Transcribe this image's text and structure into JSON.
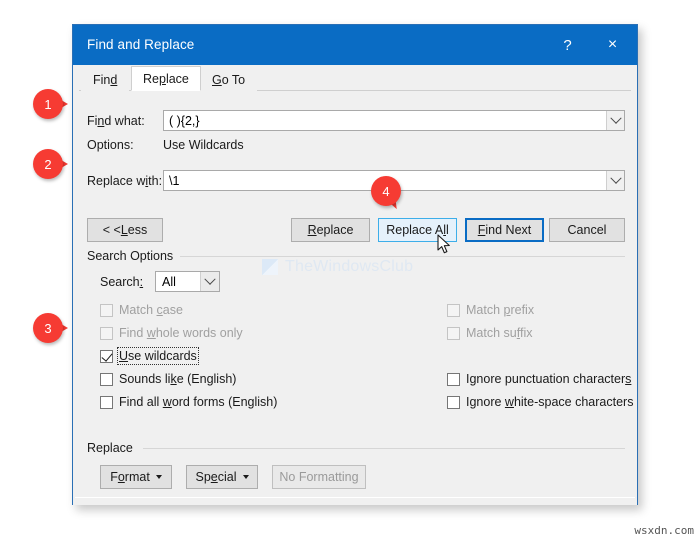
{
  "window": {
    "title": "Find and Replace",
    "help_icon": "?",
    "close_icon": "×"
  },
  "tabs": [
    {
      "label": "Find",
      "accel_before": "Fin",
      "accel": "d",
      "accel_after": "",
      "active": false
    },
    {
      "label": "Replace",
      "accel_before": "Re",
      "accel": "p",
      "accel_after": "lace",
      "active": true
    },
    {
      "label": "Go To",
      "accel_before": "",
      "accel": "G",
      "accel_after": "o To",
      "active": false
    }
  ],
  "fields": {
    "find_what_label": "Find what:",
    "find_what_accel_before": "Fi",
    "find_what_accel": "n",
    "find_what_accel_after": "d what:",
    "find_what_value": "( ){2,}",
    "options_label": "Options:",
    "options_value": "Use Wildcards",
    "replace_with_label": "Replace with:",
    "replace_with_accel_before": "Replace w",
    "replace_with_accel": "i",
    "replace_with_accel_after": "th:",
    "replace_with_value": "\\1"
  },
  "buttons": {
    "less": "< < Less",
    "less_accel_before": "< < ",
    "less_accel": "L",
    "less_accel_after": "ess",
    "replace": "Replace",
    "replace_accel_before": "",
    "replace_accel": "R",
    "replace_accel_after": "eplace",
    "replace_all": "Replace All",
    "replace_all_accel_before": "Replace A",
    "replace_all_accel": "l",
    "replace_all_accel_after": "l",
    "find_next": "Find Next",
    "find_next_accel_before": "",
    "find_next_accel": "F",
    "find_next_accel_after": "ind Next",
    "cancel": "Cancel"
  },
  "search_options": {
    "group_label": "Search Options",
    "search_label": "Search:",
    "search_accel_before": "Search",
    "search_accel": ":",
    "search_accel_after": "",
    "search_value": "All",
    "left_checkboxes": [
      {
        "label": "Match case",
        "accel_before": "Match ",
        "accel": "c",
        "accel_after": "ase",
        "checked": false,
        "disabled": true,
        "focused": false
      },
      {
        "label": "Find whole words only",
        "accel_before": "Find ",
        "accel": "w",
        "accel_after": "hole words only",
        "checked": false,
        "disabled": true,
        "focused": false
      },
      {
        "label": "Use wildcards",
        "accel_before": "",
        "accel": "U",
        "accel_after": "se wildcards",
        "checked": true,
        "disabled": false,
        "focused": true
      },
      {
        "label": "Sounds like (English)",
        "accel_before": "Sounds li",
        "accel": "k",
        "accel_after": "e (English)",
        "checked": false,
        "disabled": false,
        "focused": false
      },
      {
        "label": "Find all word forms (English)",
        "accel_before": "Find all ",
        "accel": "w",
        "accel_after": "ord forms (English)",
        "checked": false,
        "disabled": false,
        "focused": false
      }
    ],
    "right_checkboxes": [
      {
        "label": "Match prefix",
        "accel_before": "Match ",
        "accel": "p",
        "accel_after": "refix",
        "checked": false,
        "disabled": true,
        "focused": false
      },
      {
        "label": "Match suffix",
        "accel_before": "Match su",
        "accel": "f",
        "accel_after": "fix",
        "checked": false,
        "disabled": true,
        "focused": false
      },
      {
        "label": "Ignore punctuation characters",
        "accel_before": "Ignore punctuation character",
        "accel": "s",
        "accel_after": "",
        "checked": false,
        "disabled": false,
        "focused": false
      },
      {
        "label": "Ignore white-space characters",
        "accel_before": "Ignore ",
        "accel": "w",
        "accel_after": "hite-space characters",
        "checked": false,
        "disabled": false,
        "focused": false
      }
    ]
  },
  "replace_group": {
    "group_label": "Replace",
    "format_label": "Format",
    "format_accel_before": "F",
    "format_accel": "o",
    "format_accel_after": "rmat",
    "special_label": "Special",
    "special_accel_before": "Sp",
    "special_accel": "e",
    "special_accel_after": "cial",
    "no_formatting_label": "No Formatting"
  },
  "callouts": [
    {
      "number": "1"
    },
    {
      "number": "2"
    },
    {
      "number": "3"
    },
    {
      "number": "4"
    }
  ],
  "watermark": {
    "text": "TheWindowsClub"
  },
  "footer": {
    "text": "wsxdn.com"
  },
  "colors": {
    "titlebar": "#0a6cc4",
    "callout": "#f63b33",
    "dialog_bg": "#f0f0f0",
    "default_button_border": "#0a6cc4",
    "hover_button_border": "#3daee9"
  }
}
